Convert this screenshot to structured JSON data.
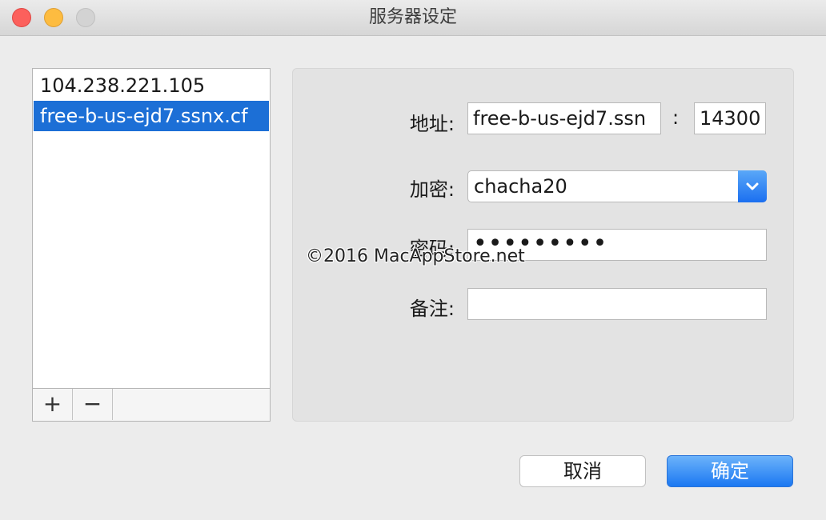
{
  "window": {
    "title": "服务器设定"
  },
  "server_list": {
    "items": [
      {
        "label": "104.238.221.105",
        "selected": false
      },
      {
        "label": "free-b-us-ejd7.ssnx.cf",
        "selected": true
      }
    ],
    "add_label": "+",
    "remove_label": "−"
  },
  "settings": {
    "address_label": "地址:",
    "address_value": "free-b-us-ejd7.ssn",
    "port_separator": ":",
    "port_value": "14300",
    "encryption_label": "加密:",
    "encryption_value": "chacha20",
    "password_label": "密码:",
    "password_value": "•••••••••",
    "remark_label": "备注:",
    "remark_value": ""
  },
  "watermark": "©2016 MacAppStore.net",
  "buttons": {
    "cancel_label": "取消",
    "ok_label": "确定"
  },
  "colors": {
    "selection": "#1c6fd6",
    "accent_button": "#1b78f2",
    "close": "#fc605c",
    "minimize": "#fdbc40"
  }
}
